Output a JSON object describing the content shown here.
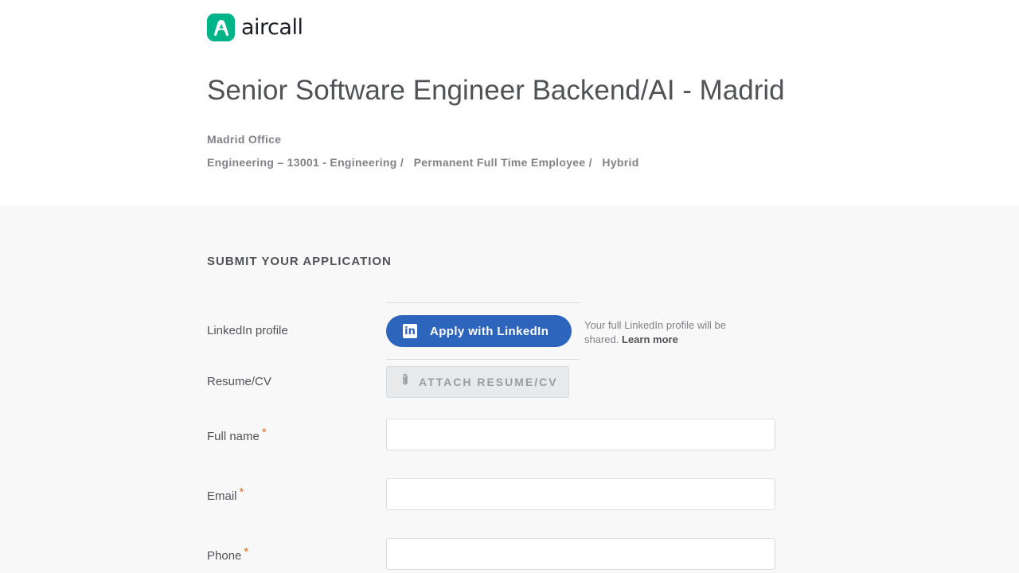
{
  "brand": {
    "name": "aircall",
    "color": "#00b388"
  },
  "job": {
    "title": "Senior Software Engineer Backend/AI - Madrid",
    "location": "Madrid Office",
    "department": "Engineering – 13001 - Engineering /",
    "employment_type": "Permanent Full Time Employee /",
    "workplace": "Hybrid"
  },
  "application": {
    "section_title": "SUBMIT YOUR APPLICATION",
    "linkedin": {
      "label": "LinkedIn profile",
      "button_label": "Apply with LinkedIn",
      "icon": "in",
      "note": "Your full LinkedIn profile will be shared.",
      "learn_more": "Learn more"
    },
    "resume": {
      "label": "Resume/CV",
      "button_label": "ATTACH RESUME/CV"
    },
    "fields": {
      "full_name": {
        "label": "Full name",
        "required": "*",
        "value": ""
      },
      "email": {
        "label": "Email",
        "required": "*",
        "value": ""
      },
      "phone": {
        "label": "Phone",
        "required": "*",
        "value": ""
      }
    }
  },
  "colors": {
    "accent": "#2d64bc",
    "required": "#e56d29"
  }
}
